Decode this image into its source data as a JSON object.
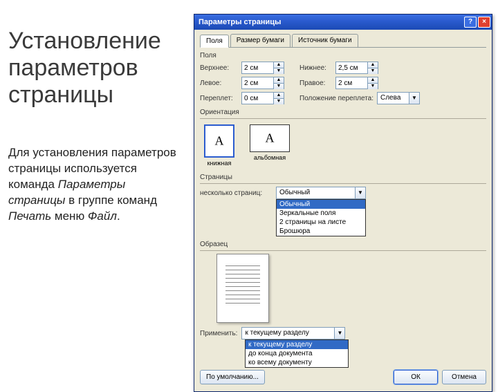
{
  "slide": {
    "title": "Установление\nпараметров\nстраницы",
    "body_prefix": "Для установления параметров страницы используется команда ",
    "italic1": "Параметры страницы",
    "mid1": " в группе команд ",
    "italic2": "Печать",
    "mid2": " меню ",
    "italic3": "Файл",
    "suffix": "."
  },
  "dialog": {
    "title": "Параметры страницы",
    "help": "?",
    "close": "×",
    "tabs": [
      "Поля",
      "Размер бумаги",
      "Источник бумаги"
    ],
    "active_tab": 0,
    "fields_group": "Поля",
    "margins": {
      "top_label": "Верхнее:",
      "top_value": "2 см",
      "bottom_label": "Нижнее:",
      "bottom_value": "2,5 см",
      "left_label": "Левое:",
      "left_value": "2 см",
      "right_label": "Правое:",
      "right_value": "2 см",
      "gutter_label": "Переплет:",
      "gutter_value": "0 см",
      "gutter_pos_label": "Положение переплета:",
      "gutter_pos_value": "Слева"
    },
    "orient": {
      "group": "Ориентация",
      "portrait": "книжная",
      "landscape": "альбомная"
    },
    "pages": {
      "group": "Страницы",
      "multi_label": "несколько страниц:",
      "value": "Обычный",
      "options": [
        "Обычный",
        "Зеркальные поля",
        "2 страницы на листе",
        "Брошюра"
      ]
    },
    "preview": {
      "group": "Образец"
    },
    "apply": {
      "label": "Применить:",
      "value": "к текущему разделу",
      "options": [
        "к текущему разделу",
        "до конца документа",
        "ко всему документу"
      ]
    },
    "buttons": {
      "default": "По умолчанию...",
      "ok": "ОК",
      "cancel": "Отмена"
    }
  }
}
